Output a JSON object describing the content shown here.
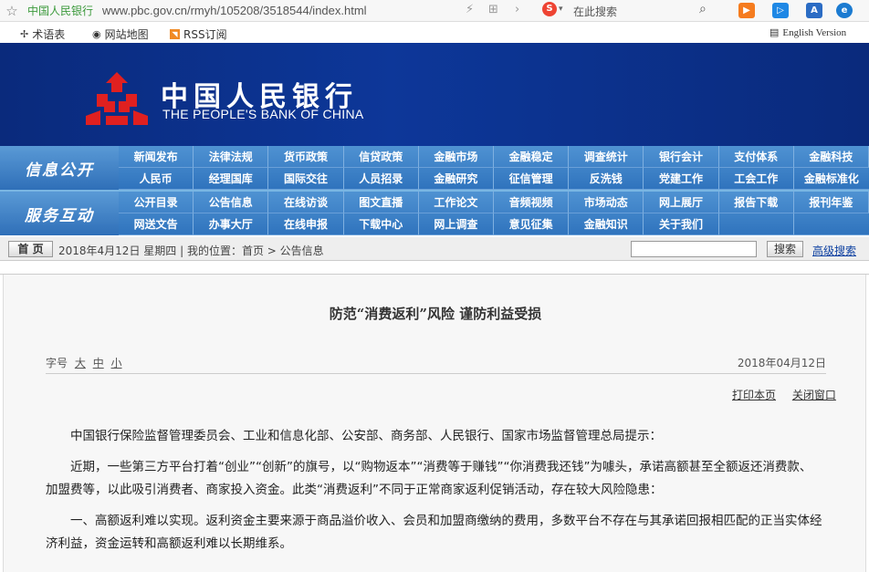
{
  "browser": {
    "site_name": "中国人民银行",
    "url": "www.pbc.gov.cn/rmyh/105208/3518544/index.html",
    "search_placeholder": "在此搜索"
  },
  "utility": {
    "glossary": "术语表",
    "sitemap": "网站地图",
    "rss": "RSS订阅",
    "english": "English Version"
  },
  "banner": {
    "name_cn": "中国人民银行",
    "name_en": "THE PEOPLE'S BANK OF CHINA"
  },
  "nav": {
    "section1": "信息公开",
    "section1_items": [
      "新闻发布",
      "法律法规",
      "货币政策",
      "信贷政策",
      "金融市场",
      "金融稳定",
      "调查统计",
      "银行会计",
      "支付体系",
      "金融科技",
      "人民币",
      "经理国库",
      "国际交往",
      "人员招录",
      "金融研究",
      "征信管理",
      "反洗钱",
      "党建工作",
      "工会工作",
      "金融标准化"
    ],
    "section2": "服务互动",
    "section2_items": [
      "公开目录",
      "公告信息",
      "在线访谈",
      "图文直播",
      "工作论文",
      "音频视频",
      "市场动态",
      "网上展厅",
      "报告下载",
      "报刊年鉴",
      "网送文告",
      "办事大厅",
      "在线申报",
      "下载中心",
      "网上调查",
      "意见征集",
      "金融知识",
      "关于我们",
      "",
      ""
    ]
  },
  "location": {
    "home": "首 页",
    "date_text": "2018年4月12日 星期四",
    "position": "我的位置：首页  >  公告信息",
    "search_button": "搜索",
    "advanced_search": "高级搜索"
  },
  "article": {
    "title": "防范“消费返利”风险 谨防利益受损",
    "font_size_label": "字号",
    "font_large": "大",
    "font_medium": "中",
    "font_small": "小",
    "date": "2018年04月12日",
    "print_link": "打印本页",
    "close_link": "关闭窗口",
    "paragraphs": [
      "中国银行保险监督管理委员会、工业和信息化部、公安部、商务部、人民银行、国家市场监督管理总局提示：",
      "近期，一些第三方平台打着“创业”“创新”的旗号，以“购物返本”“消费等于赚钱”“你消费我还钱”为噱头，承诺高额甚至全额返还消费款、加盟费等，以此吸引消费者、商家投入资金。此类“消费返利”不同于正常商家返利促销活动，存在较大风险隐患：",
      "一、高额返利难以实现。返利资金主要来源于商品溢价收入、会员和加盟商缴纳的费用，多数平台不存在与其承诺回报相匹配的正当实体经济利益，资金运转和高额返利难以长期维系。"
    ]
  },
  "colors": {
    "banner": "#0d3799",
    "nav": "#3f86cc",
    "logo_red": "#e02020"
  }
}
